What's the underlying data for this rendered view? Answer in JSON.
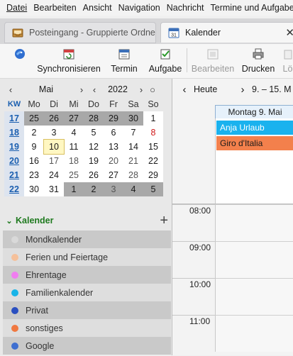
{
  "menubar": {
    "items": [
      "Datei",
      "Bearbeiten",
      "Ansicht",
      "Navigation",
      "Nachricht",
      "Termine und Aufgaben"
    ]
  },
  "tabs": [
    {
      "label": "Posteingang - Gruppierte Ordner",
      "icon": "inbox-icon",
      "active": false
    },
    {
      "label": "Kalender",
      "icon": "calendar-icon",
      "active": true
    }
  ],
  "toolbar": {
    "sync_label": "Synchronisieren",
    "termin_label": "Termin",
    "aufgabe_label": "Aufgabe",
    "bearbeiten_label": "Bearbeiten",
    "drucken_label": "Drucken",
    "loeschen_label": "Lö"
  },
  "minicalendar": {
    "month": "Mai",
    "year": "2022",
    "kw_label": "KW",
    "weekday_headers": [
      "Mo",
      "Di",
      "Mi",
      "Do",
      "Fr",
      "Sa",
      "So"
    ],
    "weeks": [
      {
        "kw": "17",
        "days": [
          "25",
          "26",
          "27",
          "28",
          "29",
          "30",
          "1"
        ]
      },
      {
        "kw": "18",
        "days": [
          "2",
          "3",
          "4",
          "5",
          "6",
          "7",
          "8"
        ]
      },
      {
        "kw": "19",
        "days": [
          "9",
          "10",
          "11",
          "12",
          "13",
          "14",
          "15"
        ]
      },
      {
        "kw": "20",
        "days": [
          "16",
          "17",
          "18",
          "19",
          "20",
          "21",
          "22"
        ]
      },
      {
        "kw": "21",
        "days": [
          "23",
          "24",
          "25",
          "26",
          "27",
          "28",
          "29"
        ]
      },
      {
        "kw": "22",
        "days": [
          "30",
          "31",
          "1",
          "2",
          "3",
          "4",
          "5"
        ]
      }
    ],
    "today": "10",
    "selected_week_kw": "19"
  },
  "calendars": {
    "header": "Kalender",
    "items": [
      {
        "name": "Mondkalender",
        "color": "#d9d9d9"
      },
      {
        "name": "Ferien und Feiertage",
        "color": "#f5c09a"
      },
      {
        "name": "Ehrentage",
        "color": "#f07ef0"
      },
      {
        "name": "Familienkalender",
        "color": "#18b4e8"
      },
      {
        "name": "Privat",
        "color": "#2a4fc0"
      },
      {
        "name": "sonstiges",
        "color": "#f07840"
      },
      {
        "name": "Google",
        "color": "#3f6fd0"
      }
    ]
  },
  "dayview": {
    "today_button": "Heute",
    "range": "9. – 15. M",
    "day_header": "Montag 9. Mai",
    "allday_events": [
      {
        "title": "Anja Urlaub",
        "color": "#1ab2ee"
      },
      {
        "title": "Giro d'Italia",
        "color": "#f3804c"
      }
    ],
    "hours": [
      "08:00",
      "09:00",
      "10:00",
      "11:00"
    ]
  }
}
